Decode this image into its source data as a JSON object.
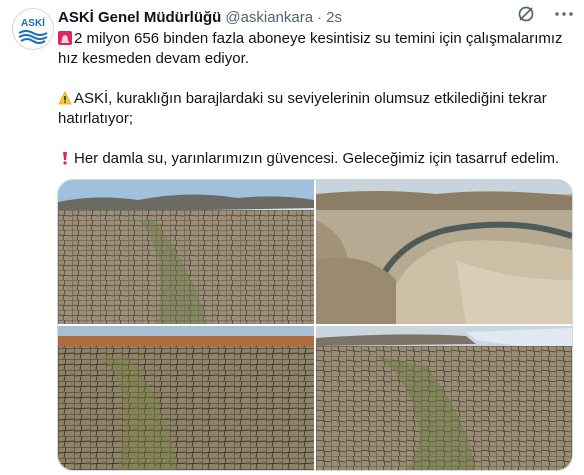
{
  "tweet": {
    "author_name": "ASKİ Genel Müdürlüğü",
    "handle": "@askiankara",
    "separator": "·",
    "time": "2s",
    "avatar_text": "ASKİ",
    "lines": [
      {
        "emoji": "rotating-light-icon",
        "text": "2 milyon 656 binden fazla aboneye kesintisiz su temini için çalışmalarımız hız kesmeden devam ediyor."
      },
      {
        "emoji": "warning-icon",
        "text": "ASKİ, kuraklığın barajlardaki su seviyelerinin olumsuz etkilediğini tekrar hatırlatıyor;"
      },
      {
        "emoji": "exclamation-icon",
        "text": "Her damla su, yarınlarımızın güvencesi. Geleceğimiz için tasarruf edelim."
      }
    ]
  },
  "media": {
    "photos": [
      {
        "name": "dry-cracked-reservoir-bed-photo"
      },
      {
        "name": "aerial-drying-reservoir-photo"
      },
      {
        "name": "cracked-earth-red-soil-photo"
      },
      {
        "name": "cracked-lakebed-shoreline-photo"
      }
    ]
  },
  "colors": {
    "text": "#0f1419",
    "muted": "#536471",
    "border": "#cfd9de",
    "brand_blue": "#1d6fb8"
  }
}
